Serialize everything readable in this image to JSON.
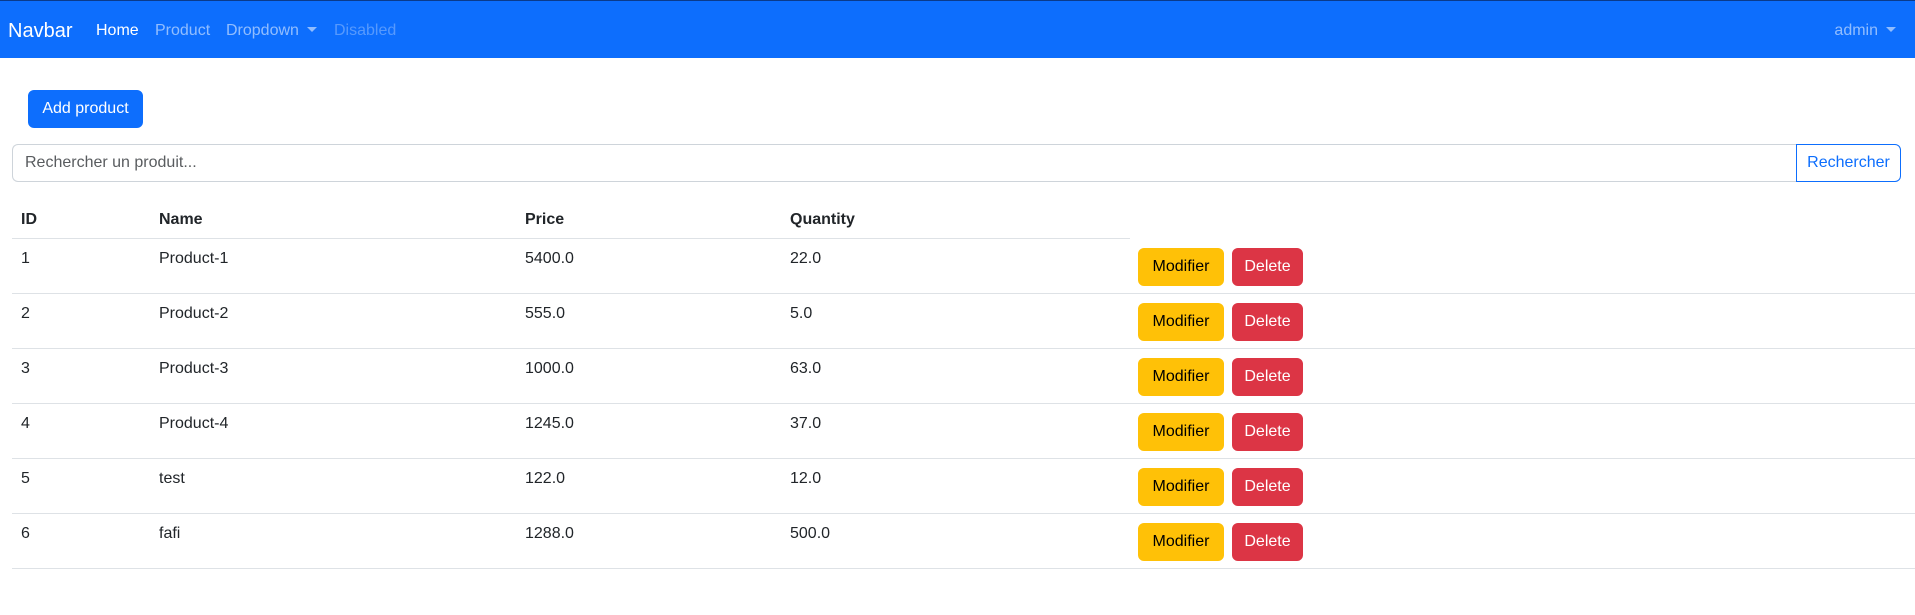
{
  "navbar": {
    "brand": "Navbar",
    "links": {
      "home": "Home",
      "product": "Product",
      "dropdown": "Dropdown",
      "disabled": "Disabled"
    },
    "user": "admin"
  },
  "actions": {
    "add_product": "Add product"
  },
  "search": {
    "placeholder": "Rechercher un produit...",
    "value": "",
    "button": "Rechercher"
  },
  "table": {
    "headers": {
      "id": "ID",
      "name": "Name",
      "price": "Price",
      "quantity": "Quantity"
    },
    "edit_label": "Modifier",
    "delete_label": "Delete",
    "rows": [
      {
        "id": "1",
        "name": "Product-1",
        "price": "5400.0",
        "quantity": "22.0"
      },
      {
        "id": "2",
        "name": "Product-2",
        "price": "555.0",
        "quantity": "5.0"
      },
      {
        "id": "3",
        "name": "Product-3",
        "price": "1000.0",
        "quantity": "63.0"
      },
      {
        "id": "4",
        "name": "Product-4",
        "price": "1245.0",
        "quantity": "37.0"
      },
      {
        "id": "5",
        "name": "test",
        "price": "122.0",
        "quantity": "12.0"
      },
      {
        "id": "6",
        "name": "fafi",
        "price": "1288.0",
        "quantity": "500.0"
      }
    ]
  },
  "colors": {
    "primary": "#0d6efd",
    "warning": "#ffc107",
    "danger": "#dc3545",
    "border": "#dee2e6"
  }
}
